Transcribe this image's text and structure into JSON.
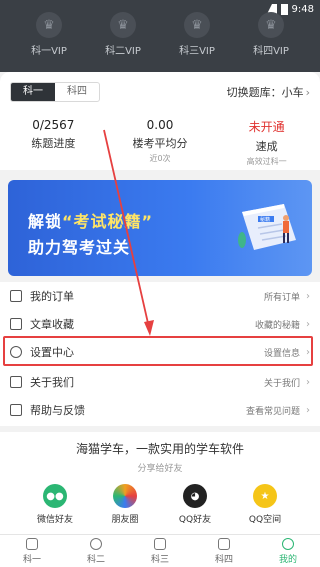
{
  "status_bar": {
    "time": "9:48"
  },
  "vip_tabs": [
    {
      "label": "科一VIP"
    },
    {
      "label": "科二VIP"
    },
    {
      "label": "科三VIP"
    },
    {
      "label": "科四VIP"
    }
  ],
  "subject_tabs": [
    {
      "label": "科一",
      "active": true
    },
    {
      "label": "科四",
      "active": false
    }
  ],
  "switch_bank": {
    "label": "切换题库：小车"
  },
  "stats": [
    {
      "value": "0/2567",
      "label": "练题进度",
      "sub": ""
    },
    {
      "value": "0.00",
      "label": "楼考平均分",
      "sub": "近0次"
    },
    {
      "value": "未开通",
      "label": "速成",
      "sub": "高效过科一"
    }
  ],
  "banner": {
    "line1_prefix": "解锁",
    "line1_highlight": "“考试秘籍”",
    "line2": "助力驾考过关",
    "book_label": "秘籍"
  },
  "menu": [
    {
      "label": "我的订单",
      "right": "所有订单"
    },
    {
      "label": "文章收藏",
      "right": "收藏的秘籍"
    },
    {
      "label": "设置中心",
      "right": "设置信息"
    },
    {
      "label": "关于我们",
      "right": "关于我们"
    },
    {
      "label": "帮助与反馈",
      "right": "查看常见问题"
    }
  ],
  "share": {
    "title": "海猫学车，一款实用的学车软件",
    "subtitle": "分享给好友",
    "items": [
      {
        "label": "微信好友",
        "color": "#2bb673"
      },
      {
        "label": "朋友圈",
        "color": "#f0a020"
      },
      {
        "label": "QQ好友",
        "color": "#222222"
      },
      {
        "label": "QQ空间",
        "color": "#f5c518"
      }
    ]
  },
  "nav": [
    {
      "label": "科一"
    },
    {
      "label": "科二"
    },
    {
      "label": "科三"
    },
    {
      "label": "科四"
    },
    {
      "label": "我的",
      "active": true
    }
  ]
}
